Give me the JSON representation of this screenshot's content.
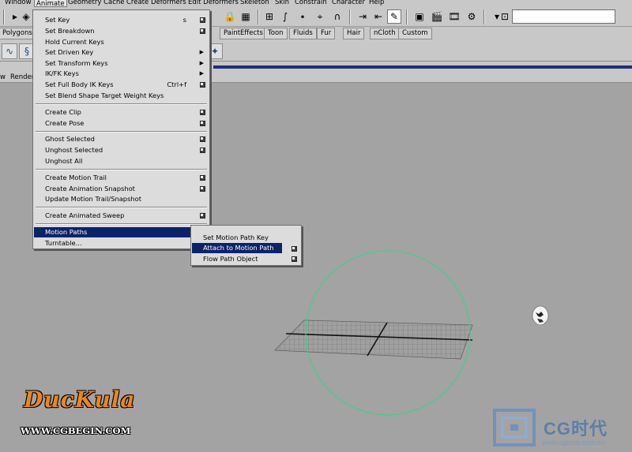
{
  "menubar": {
    "items": [
      "Window",
      "Animate",
      "Geometry Cache",
      "Create Deformers",
      "Edit Deformers",
      "Skeleton",
      "Skin",
      "Constrain",
      "Character",
      "Help"
    ]
  },
  "shelf_tabs": [
    "Polygons",
    "PaintEffects",
    "Toon",
    "Fluids",
    "Fur",
    "Hair",
    "nCloth",
    "Custom"
  ],
  "panel_menu": [
    "w",
    "Render"
  ],
  "animate_menu": {
    "items": [
      {
        "label": "Set Key",
        "shortcut": "s",
        "option_box": true
      },
      {
        "label": "Set Breakdown",
        "option_box": true
      },
      {
        "label": "Hold Current Keys"
      },
      {
        "label": "Set Driven Key",
        "submenu": true
      },
      {
        "label": "Set Transform Keys",
        "submenu": true
      },
      {
        "label": "IK/FK Keys",
        "submenu": true
      },
      {
        "label": "Set Full Body IK Keys",
        "shortcut": "Ctrl+f",
        "option_box": true
      },
      {
        "label": "Set Blend Shape Target Weight Keys"
      },
      {
        "label": "Create Clip",
        "option_box": true
      },
      {
        "label": "Create Pose",
        "option_box": true
      },
      {
        "label": "Ghost Selected",
        "option_box": true
      },
      {
        "label": "Unghost Selected",
        "option_box": true
      },
      {
        "label": "Unghost All"
      },
      {
        "label": "Create Motion Trail",
        "option_box": true
      },
      {
        "label": "Create Animation Snapshot",
        "option_box": true
      },
      {
        "label": "Update Motion Trail/Snapshot"
      },
      {
        "label": "Create Animated Sweep",
        "option_box": true
      },
      {
        "label": "Motion Paths",
        "submenu": true,
        "highlighted": true
      },
      {
        "label": "Turntable..."
      }
    ]
  },
  "motion_paths_submenu": {
    "items": [
      {
        "label": "Set Motion Path Key"
      },
      {
        "label": "Attach to Motion Path",
        "option_box": true,
        "highlighted": true
      },
      {
        "label": "Flow Path Object",
        "option_box": true
      }
    ]
  },
  "watermark_left": {
    "brand": "DucKula",
    "url": "WWW.CGBEGIN.COM"
  },
  "watermark_right": {
    "brand": "CG时代",
    "url": "www.cgtime.com.cn"
  },
  "colors": {
    "viewport_bg": "#a3a3a3",
    "menu_bg": "#dcdcdc",
    "highlight": "#0a246a",
    "circle": "#3fd08c",
    "brand_orange": "#e8871e"
  }
}
